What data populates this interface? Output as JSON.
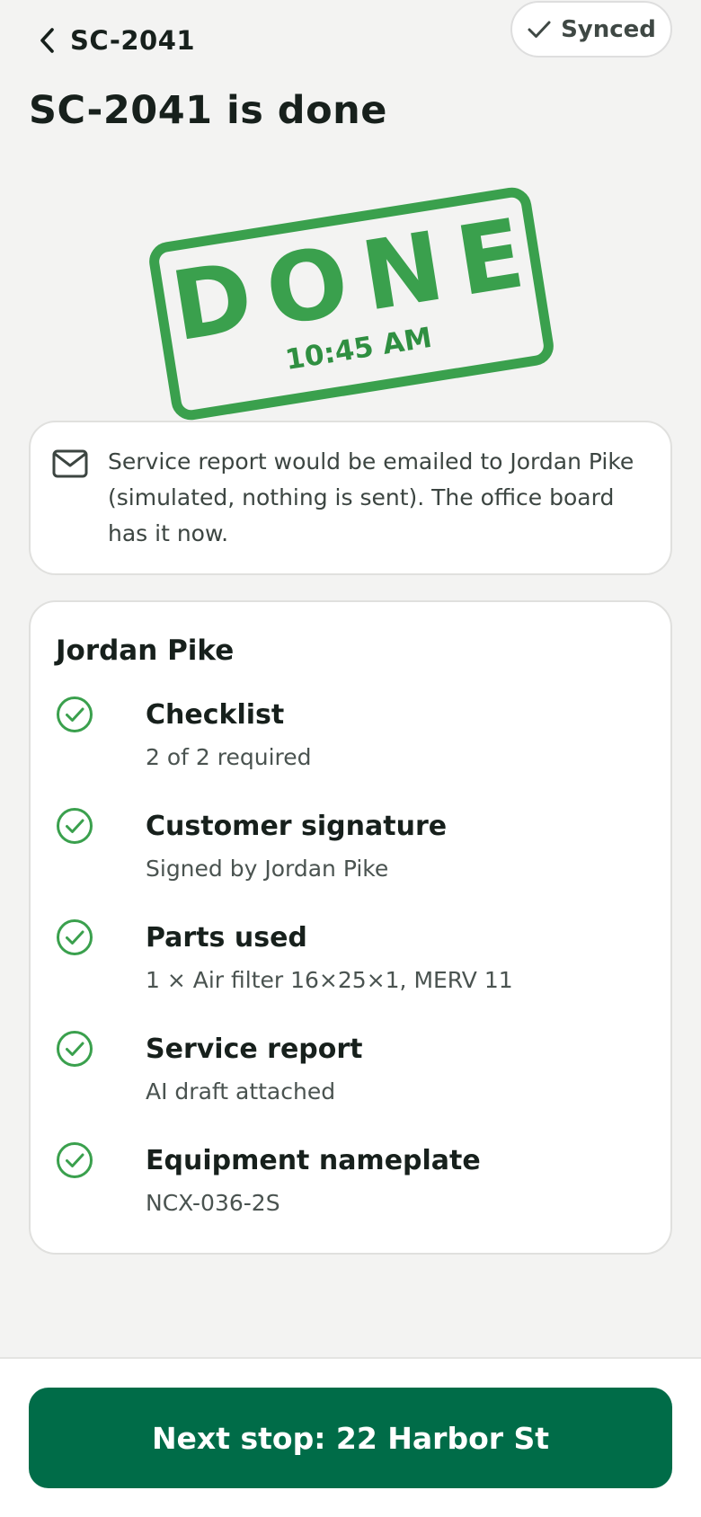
{
  "header": {
    "back_label": "SC-2041",
    "sync_status": "Synced",
    "title": "SC-2041 is done"
  },
  "stamp": {
    "word": "DONE",
    "time": "10:45 AM",
    "color": "#3aa04d"
  },
  "notice": {
    "icon": "mail-icon",
    "text": "Service report would be emailed to Jordan Pike (simulated, nothing is sent). The office board has it now."
  },
  "summary": {
    "customer_name": "Jordan Pike",
    "items": [
      {
        "title": "Checklist",
        "detail": "2 of 2 required",
        "status": "complete"
      },
      {
        "title": "Customer signature",
        "detail": "Signed by Jordan Pike",
        "status": "complete"
      },
      {
        "title": "Parts used",
        "detail": "1 × Air filter 16×25×1, MERV 11",
        "status": "complete"
      },
      {
        "title": "Service report",
        "detail": "AI draft attached",
        "status": "complete"
      },
      {
        "title": "Equipment nameplate",
        "detail": "NCX-036-2S",
        "status": "complete"
      }
    ]
  },
  "footer": {
    "next_button_label": "Next stop: 22 Harbor St"
  },
  "colors": {
    "accent": "#006c48",
    "check": "#3aa04d",
    "background": "#f3f3f2"
  }
}
